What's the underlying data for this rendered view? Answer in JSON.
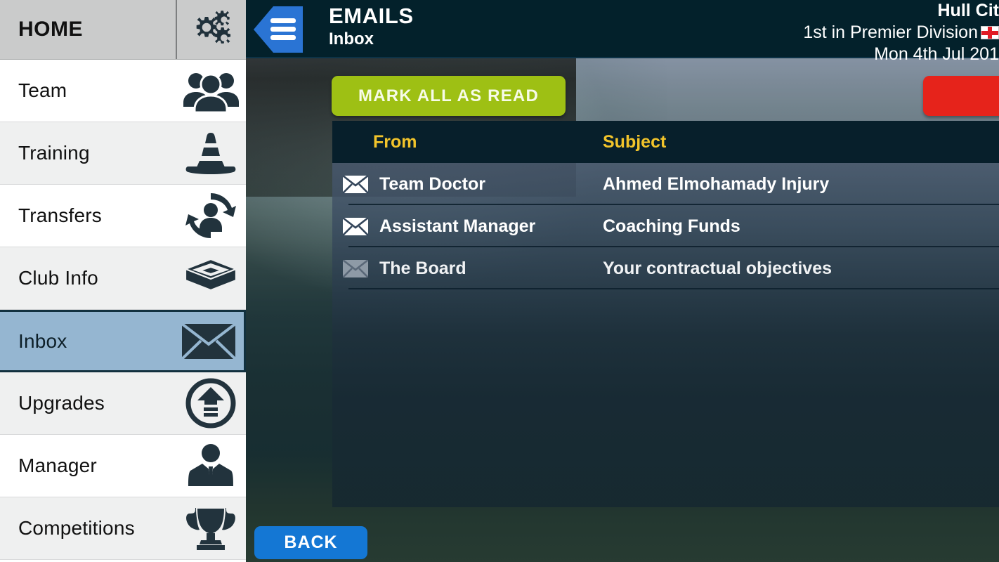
{
  "sidebar": {
    "header": {
      "label": "HOME",
      "icon": "gears-icon"
    },
    "items": [
      {
        "label": "Team",
        "icon": "team-group-icon",
        "selected": false
      },
      {
        "label": "Training",
        "icon": "traffic-cone-icon",
        "selected": false
      },
      {
        "label": "Transfers",
        "icon": "transfer-person-icon",
        "selected": false
      },
      {
        "label": "Club Info",
        "icon": "stadium-icon",
        "selected": false
      },
      {
        "label": "Inbox",
        "icon": "envelope-icon",
        "selected": true
      },
      {
        "label": "Upgrades",
        "icon": "upgrade-arrow-icon",
        "selected": false
      },
      {
        "label": "Manager",
        "icon": "manager-suit-icon",
        "selected": false
      },
      {
        "label": "Competitions",
        "icon": "trophy-icon",
        "selected": false
      }
    ]
  },
  "topbar": {
    "menu_icon": "hamburger-menu-icon",
    "title": "EMAILS",
    "subtitle": "Inbox",
    "club_name": "Hull Cit",
    "league_position": "1st in Premier Division",
    "nation_flag": "england-flag-icon",
    "date": "Mon 4th Jul 201"
  },
  "toolbar": {
    "mark_all_read_label": "MARK ALL AS READ",
    "danger_label": ""
  },
  "email_table": {
    "columns": [
      "From",
      "Subject"
    ],
    "rows": [
      {
        "from": "Team Doctor",
        "subject": "Ahmed Elmohamady Injury",
        "read": false,
        "icon": "unread-envelope-icon"
      },
      {
        "from": "Assistant Manager",
        "subject": "Coaching Funds",
        "read": false,
        "icon": "unread-envelope-icon"
      },
      {
        "from": "The Board",
        "subject": "Your contractual objectives",
        "read": true,
        "icon": "read-envelope-icon"
      }
    ]
  },
  "footer": {
    "back_label": "BACK"
  },
  "colors": {
    "accent_green": "#9ec014",
    "accent_red": "#e6231b",
    "accent_blue": "#1477d4",
    "header_navy": "#03212b",
    "column_header_yellow": "#f2c42b",
    "selected_row_blue": "#95b6d1"
  }
}
